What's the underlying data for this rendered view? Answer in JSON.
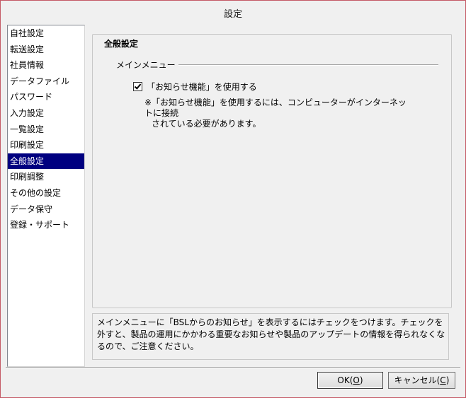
{
  "window": {
    "title": "設定"
  },
  "sidebar": {
    "items": [
      {
        "label": "自社設定"
      },
      {
        "label": "転送設定"
      },
      {
        "label": "社員情報"
      },
      {
        "label": "データファイル"
      },
      {
        "label": "パスワード"
      },
      {
        "label": "入力設定"
      },
      {
        "label": "一覧設定"
      },
      {
        "label": "印刷設定"
      },
      {
        "label": "全般設定",
        "selected": true
      },
      {
        "label": "印刷調整"
      },
      {
        "label": "その他の設定"
      },
      {
        "label": "データ保守"
      },
      {
        "label": "登録・サポート"
      }
    ]
  },
  "panel": {
    "group_title": "全般設定",
    "section_title": "メインメニュー",
    "checkbox_label": "「お知らせ機能」を使用する",
    "checkbox_checked": true,
    "note_line1": "※「お知らせ機能」を使用するには、コンピューターがインターネットに接続",
    "note_line2": "されている必要があります。",
    "help_text": "メインメニューに「BSLからのお知らせ」を表示するにはチェックをつけます。チェックを外すと、製品の運用にかかわる重要なお知らせや製品のアップデートの情報を得られなくなるので、ご注意ください。"
  },
  "buttons": {
    "ok_label": "OK(",
    "ok_key": "O",
    "ok_suffix": ")",
    "cancel_label": "キャンセル(",
    "cancel_key": "C",
    "cancel_suffix": ")"
  }
}
